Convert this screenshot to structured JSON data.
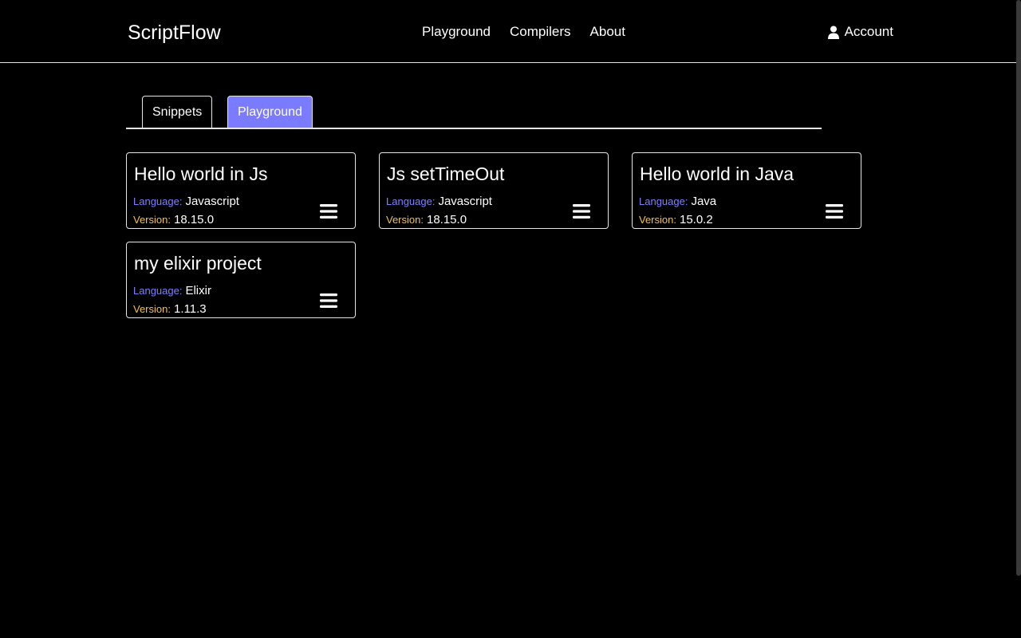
{
  "header": {
    "brand": "ScriptFlow",
    "nav": [
      "Playground",
      "Compilers",
      "About"
    ],
    "account_label": "Account"
  },
  "tabs": {
    "snippets": "Snippets",
    "playground": "Playground",
    "active": "Playground",
    "active_color": "#7b7bff"
  },
  "labels": {
    "language": "Language:",
    "version": "Version:",
    "language_color": "#8080ff",
    "version_color": "#f2c14e"
  },
  "cards": [
    {
      "title": "Hello world in Js",
      "language": "Javascript",
      "version": "18.15.0"
    },
    {
      "title": "Js setTimeOut",
      "language": "Javascript",
      "version": "18.15.0"
    },
    {
      "title": "Hello world in Java",
      "language": "Java",
      "version": "15.0.2"
    },
    {
      "title": "my elixir project",
      "language": "Elixir",
      "version": "1.11.3"
    }
  ],
  "icons": {
    "account": "user-icon",
    "card_menu": "hamburger-menu-icon"
  }
}
